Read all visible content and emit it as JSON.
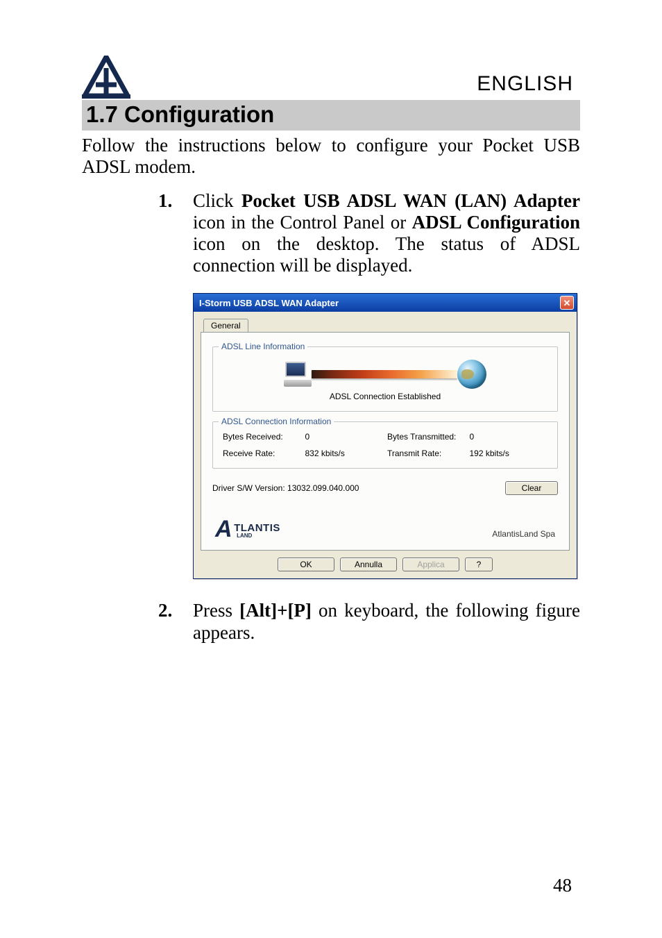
{
  "header": {
    "language": "ENGLISH",
    "section_number": "1.7",
    "section_title": "Configuration"
  },
  "intro": "Follow the instructions below to configure your Pocket USB ADSL modem.",
  "steps": {
    "1": {
      "num": "1.",
      "pre": "Click ",
      "bold1": "Pocket USB ADSL WAN (LAN) Adapter",
      "mid": " icon in the Control Panel or ",
      "bold2": "ADSL Configuration",
      "post": " icon on the desktop. The status of ADSL connection will be displayed."
    },
    "2": {
      "num": "2.",
      "pre": "Press ",
      "bold1": "[Alt]+[P]",
      "post": " on keyboard, the following figure appears."
    }
  },
  "dialog": {
    "title": "I-Storm USB ADSL WAN Adapter",
    "tab": "General",
    "group_line": "ADSL Line Information",
    "status": "ADSL Connection Established",
    "group_conn": "ADSL Connection Information",
    "rows": {
      "bytes_received_label": "Bytes Received:",
      "bytes_received_value": "0",
      "bytes_transmitted_label": "Bytes Transmitted:",
      "bytes_transmitted_value": "0",
      "receive_rate_label": "Receive Rate:",
      "receive_rate_value": "832 kbits/s",
      "transmit_rate_label": "Transmit Rate:",
      "transmit_rate_value": "192 kbits/s"
    },
    "driver_version": "Driver S/W Version: 13032.099.040.000",
    "clear_btn": "Clear",
    "brand_line": "AtlantisLand Spa",
    "logo_main": "TLANTIS",
    "logo_sub": "LAND",
    "buttons": {
      "ok": "OK",
      "cancel": "Annulla",
      "apply": "Applica",
      "help": "?"
    }
  },
  "page_number": "48"
}
